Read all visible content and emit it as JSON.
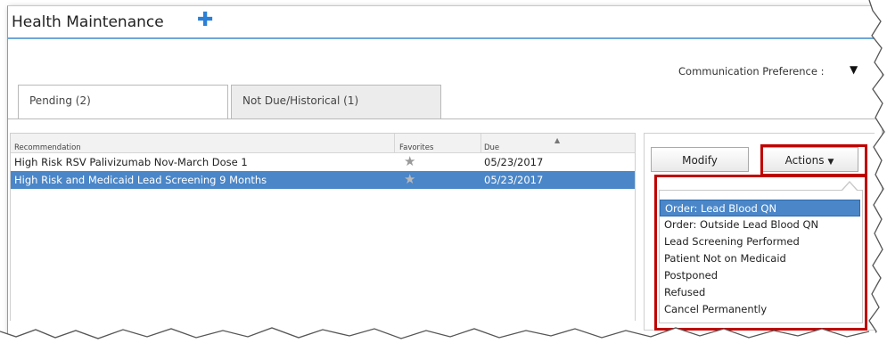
{
  "header": {
    "title": "Health Maintenance",
    "add_icon": "plus-icon"
  },
  "communication": {
    "label": "Communication Preference :",
    "arrow_icon": "caret-down-icon"
  },
  "tabs": [
    {
      "label": "Pending (2)",
      "active": true
    },
    {
      "label": "Not Due/Historical (1)",
      "active": false
    }
  ],
  "grid": {
    "columns": [
      "Recommendation",
      "Favorites",
      "Due"
    ],
    "rows": [
      {
        "recommendation": "High Risk RSV Palivizumab Nov-March Dose 1",
        "favorite_icon": "star-icon",
        "due": "05/23/2017",
        "selected": false
      },
      {
        "recommendation": "High Risk and Medicaid Lead Screening 9 Months",
        "favorite_icon": "star-icon",
        "due": "05/23/2017",
        "selected": true
      }
    ]
  },
  "buttons": {
    "modify": "Modify",
    "actions": "Actions"
  },
  "actions_menu": [
    "Order: Lead Blood QN",
    "Order: Outside Lead Blood QN",
    "Lead Screening Performed",
    "Patient Not on Medicaid",
    "Postponed",
    "Refused",
    "Cancel Permanently"
  ],
  "colors": {
    "accent": "#2b7fd4",
    "selection": "#4a86c8",
    "highlight_box": "#c00000"
  }
}
